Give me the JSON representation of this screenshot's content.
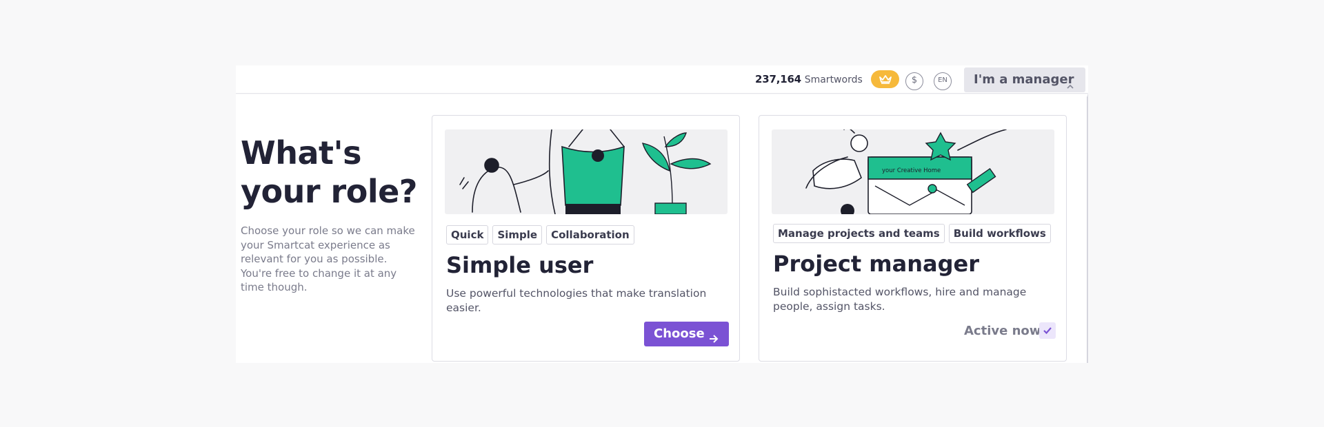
{
  "header": {
    "smartwords_count": "237,164",
    "smartwords_label": "Smartwords",
    "currency_symbol": "$",
    "language": "EN",
    "role_button_label": "I'm a manager"
  },
  "intro": {
    "heading": "What's your role?",
    "text": "Choose your role so we can make your Smartcat experience as relevant for you as possible. You're free to change it at any time though."
  },
  "cards": [
    {
      "tags": [
        "Quick",
        "Simple",
        "Collaboration"
      ],
      "title": "Simple user",
      "description": "Use powerful technologies that make translation easier.",
      "action_label": "Choose"
    },
    {
      "tags": [
        "Manage projects and teams",
        "Build workflows"
      ],
      "title": "Project manager",
      "description": "Build sophistacted workflows, hire and manage people, assign tasks.",
      "status_label": "Active now",
      "illustration_text": "your Creative Home"
    }
  ],
  "colors": {
    "accent": "#7b52d4",
    "crown_badge": "#f6b93b",
    "illustration_green": "#1fbf8f"
  }
}
